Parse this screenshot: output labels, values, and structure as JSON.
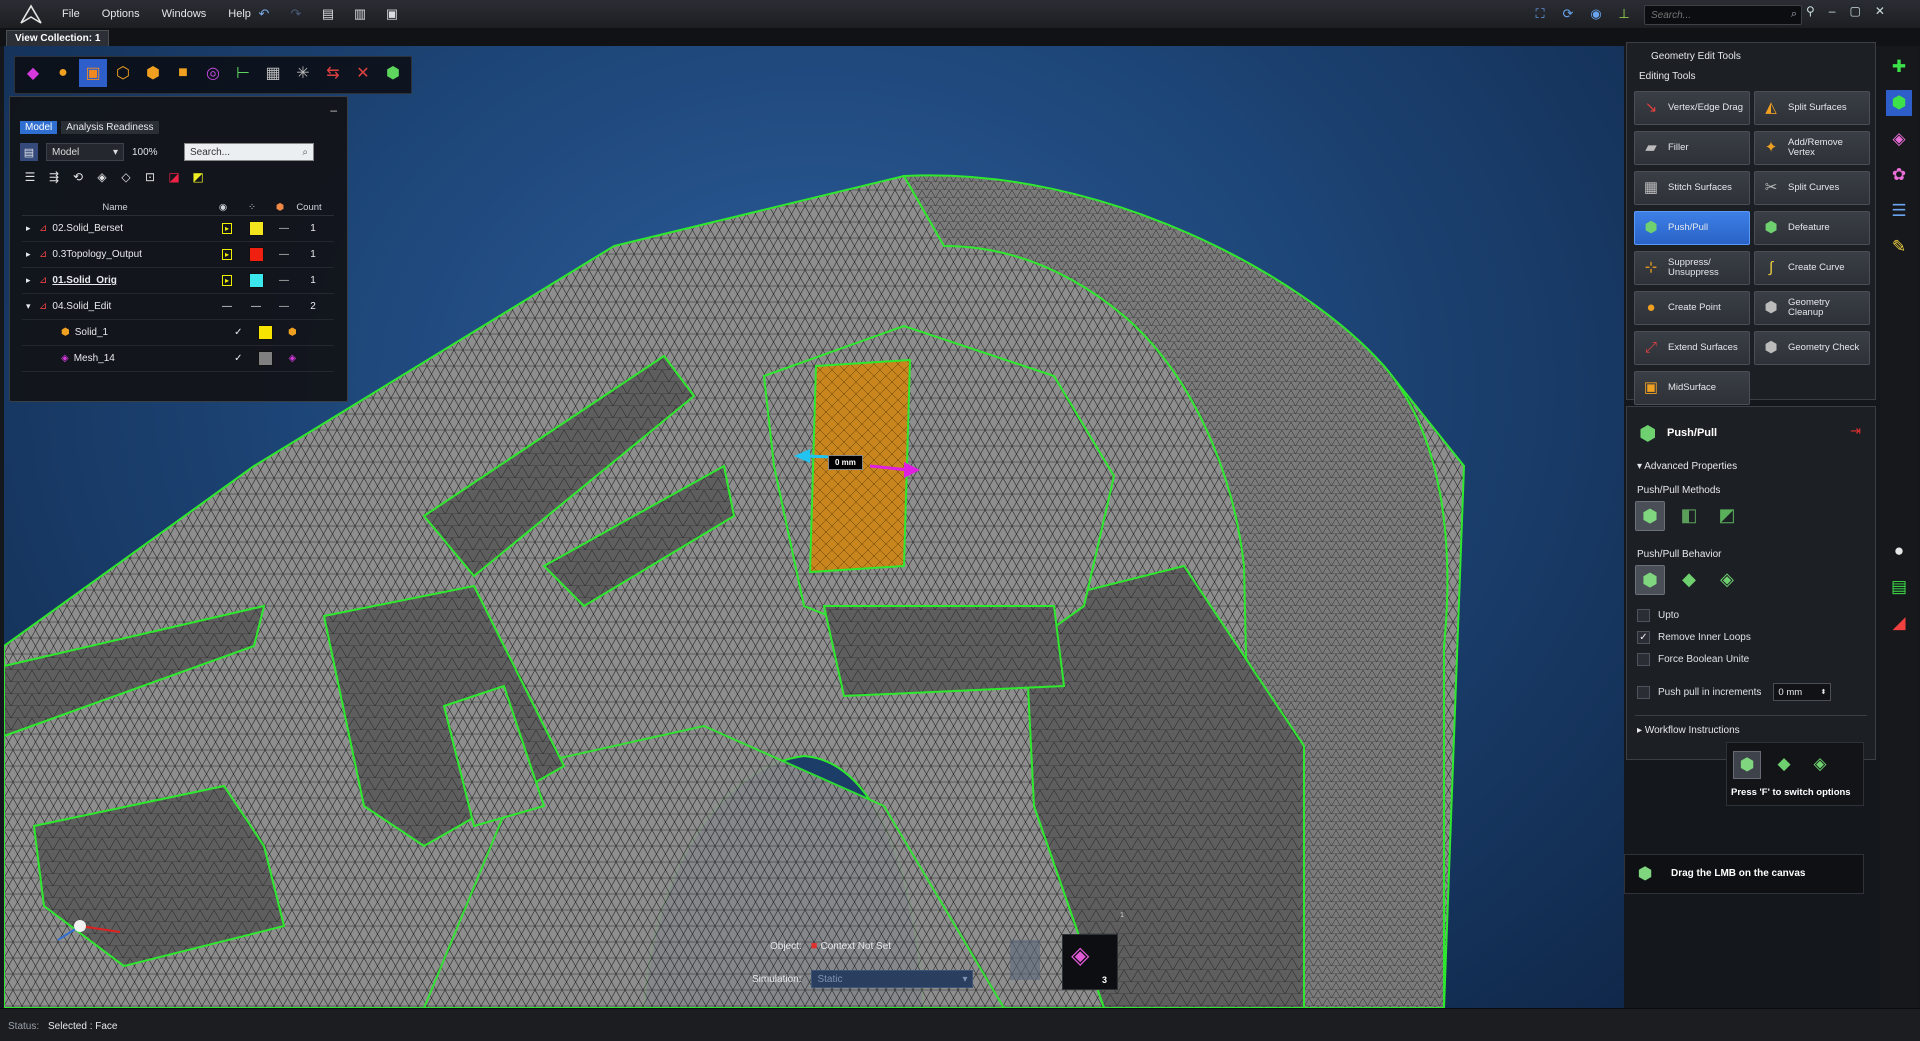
{
  "app": {
    "title": "View Collection: 1"
  },
  "menu": {
    "items": [
      "File",
      "Options",
      "Windows",
      "Help"
    ]
  },
  "search": {
    "placeholder": "Search..."
  },
  "model_panel": {
    "tabs": [
      "Model",
      "Analysis Readiness"
    ],
    "dropdown": "Model",
    "zoom": "100%",
    "search_placeholder": "Search...",
    "columns": {
      "name": "Name",
      "count": "Count"
    },
    "rows": [
      {
        "name": "02.Solid_Berset",
        "count": "1",
        "color": "#f2e51e",
        "type": "—",
        "expand": "▸"
      },
      {
        "name": "0.3Topology_Output",
        "count": "1",
        "color": "#f02010",
        "type": "—",
        "expand": "▸"
      },
      {
        "name": "01.Solid_Orig",
        "count": "1",
        "color": "#3ae8ee",
        "type": "—",
        "expand": "▸"
      },
      {
        "name": "04.Solid_Edit",
        "count": "2",
        "color": "",
        "type": "—",
        "expand": "▾"
      },
      {
        "name": "Solid_1",
        "count": "",
        "color": "#f7e400",
        "type": "cube",
        "expand": ""
      },
      {
        "name": "Mesh_14",
        "count": "",
        "color": "#808080",
        "type": "mesh",
        "expand": ""
      }
    ]
  },
  "geometry_tools": {
    "header": "Geometry Edit Tools",
    "subheader": "Editing Tools",
    "buttons": [
      "Vertex/Edge Drag",
      "Split Surfaces",
      "Filler",
      "Add/Remove Vertex",
      "Stitch Surfaces",
      "Split Curves",
      "Push/Pull",
      "Defeature",
      "Suppress/ Unsuppress",
      "Create Curve",
      "Create Point",
      "Geometry Cleanup",
      "Extend Surfaces",
      "Geometry Check",
      "MidSurface"
    ],
    "active": "Push/Pull"
  },
  "push_pull": {
    "title": "Push/Pull",
    "advanced": "Advanced Properties",
    "methods_label": "Push/Pull Methods",
    "behavior_label": "Push/Pull Behavior",
    "options": {
      "upto": "Upto",
      "remove_inner_loops": "Remove Inner Loops",
      "force_boolean": "Force Boolean Unite",
      "increments": "Push pull in increments"
    },
    "checked": {
      "upto": false,
      "remove_inner_loops": true,
      "force_boolean": false,
      "increments": false
    },
    "increment_value": "0 mm",
    "workflow": "Workflow Instructions"
  },
  "switch_popup": {
    "text": "Press 'F' to switch options"
  },
  "hint": {
    "text": "Drag the LMB on the canvas"
  },
  "viewport": {
    "gizmo_label": "0 mm",
    "object_label": "Object:",
    "object_value": "Context Not Set",
    "simulation_label": "Simulation:",
    "simulation_value": "Static",
    "mesh_badge": "3",
    "mesh_small": "1"
  },
  "status": {
    "label": "Status:",
    "value": "Selected : Face"
  },
  "colors": {
    "accent": "#2f6fd1",
    "mesh_gray": "#8c8c8c",
    "edge_green": "#2ee82e",
    "face_orange": "#c9851e"
  }
}
